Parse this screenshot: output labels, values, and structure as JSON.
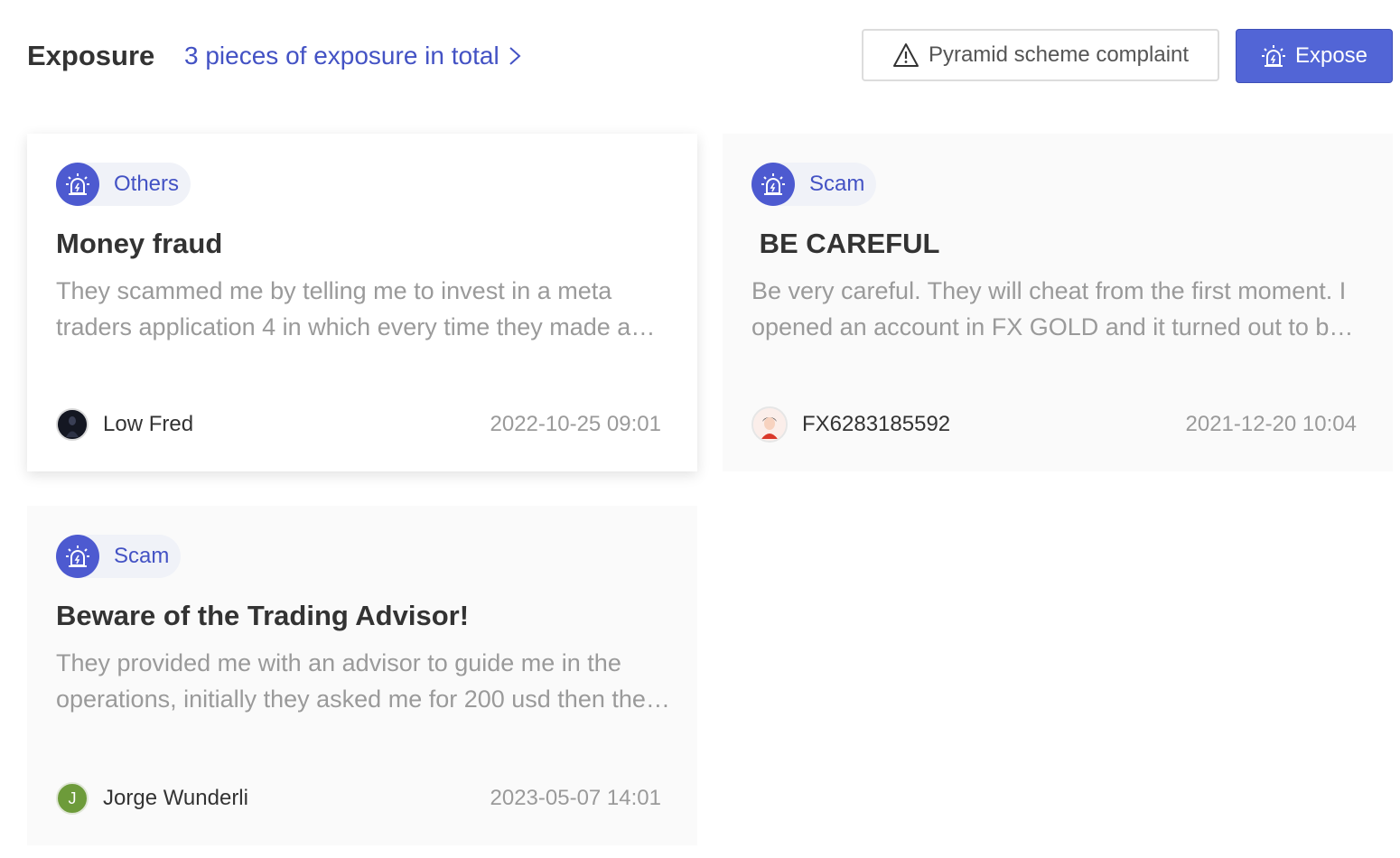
{
  "header": {
    "title": "Exposure",
    "summary_link": "3 pieces of exposure in total",
    "complaint_button": "Pyramid scheme complaint",
    "expose_button": "Expose"
  },
  "colors": {
    "accent": "#4352c4",
    "expose_button_bg": "#5265d6",
    "badge_bg": "#4d5ad0",
    "tag_bg": "#f0f2f8"
  },
  "cards": [
    {
      "category": "Others",
      "title": "Money fraud",
      "description": "They scammed me by telling me to invest in a meta traders application 4 in which every time they made a profit they asked me for more money",
      "author": "Low Fred",
      "avatar": "dark-photo-avatar",
      "date": "2022-10-25 09:01"
    },
    {
      "category": "Scam",
      "title": " BE CAREFUL",
      "description": "Be very careful. They will cheat from the first moment. I opened an account in FX GOLD and it turned out to be a trap from the start",
      "author": "FX6283185592",
      "avatar": "cartoon-person-avatar",
      "date": "2021-12-20 10:04"
    },
    {
      "category": "Scam",
      "title": "Beware of the Trading Advisor!",
      "description": "They provided me with an advisor to guide me in the operations, initially they asked me for 200 usd then they asked for more deposits",
      "author": "Jorge Wunderli",
      "avatar_initial": "J",
      "date": "2023-05-07 14:01"
    }
  ]
}
